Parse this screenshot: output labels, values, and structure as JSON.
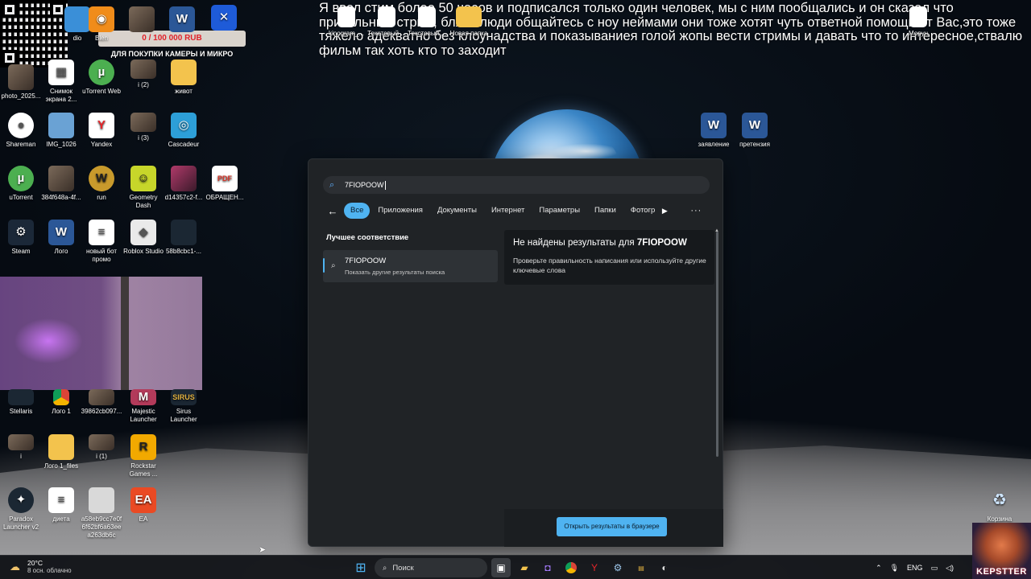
{
  "overlay": {
    "message": "Я ввел стим более 50 часов и подписался только один человек, мы с ним пообщались и он сказал что прикольный стрим, блять люди общайтесь с ноу неймами они тоже хотят чуть ответной помощи от Вас,это тоже тяжело адекватно без клоунадства и показываниея голой жопы вести стримы и давать что то интересное,ствалю фильм  так хоть кто то заходит"
  },
  "donation": {
    "progress_text": "0 / 100 000 RUB",
    "caption": "ДЛЯ ПОКУПКИ КАМЕРЫ И МИКРО"
  },
  "desktop_icons": {
    "col1": [
      {
        "label": "photo_2025...",
        "icon": "photo-icon"
      },
      {
        "label": "Shareman",
        "icon": "shareman-icon"
      },
      {
        "label": "uTorrent",
        "icon": "utorrent-icon"
      },
      {
        "label": "Steam",
        "icon": "steam-icon"
      },
      {
        "label": "Stellaris",
        "icon": "stellaris-icon"
      },
      {
        "label": "i",
        "icon": "image-icon"
      },
      {
        "label": "Paradox Launcher v2",
        "icon": "paradox-icon"
      }
    ],
    "col2": [
      {
        "label": "Снимок экрана 2...",
        "icon": "screenshot-icon"
      },
      {
        "label": "IMG_1026",
        "icon": "image-icon"
      },
      {
        "label": "384f648a-4f...",
        "icon": "image-icon"
      },
      {
        "label": "Лого",
        "icon": "word-icon"
      },
      {
        "label": "Лого 1",
        "icon": "chrome-icon"
      },
      {
        "label": "Лого 1_files",
        "icon": "folder-icon"
      },
      {
        "label": "диета",
        "icon": "document-icon"
      }
    ],
    "col3": [
      {
        "label": "uTorrent Web",
        "icon": "utorrent-web-icon"
      },
      {
        "label": "Yandex",
        "icon": "yandex-icon"
      },
      {
        "label": "run",
        "icon": "wow-icon"
      },
      {
        "label": "новый бот промо",
        "icon": "document-icon"
      },
      {
        "label": "39862cb097...",
        "icon": "image-icon"
      },
      {
        "label": "i (1)",
        "icon": "image-icon"
      },
      {
        "label": "a58eb9cc7e0f 6f62bf6a63ee a263db6c",
        "icon": "image-icon"
      }
    ],
    "col4": [
      {
        "label": "i (2)",
        "icon": "image-icon"
      },
      {
        "label": "i (3)",
        "icon": "image-icon"
      },
      {
        "label": "Geometry Dash",
        "icon": "geometry-dash-icon"
      },
      {
        "label": "Roblox Studio",
        "icon": "roblox-icon"
      },
      {
        "label": "Majestic Launcher",
        "icon": "majestic-icon"
      },
      {
        "label": "Rockstar Games ...",
        "icon": "rockstar-icon"
      },
      {
        "label": "EA",
        "icon": "ea-icon"
      }
    ],
    "col5": [
      {
        "label": "живот",
        "icon": "folder-icon"
      },
      {
        "label": "Cascadeur",
        "icon": "cascadeur-icon"
      },
      {
        "label": "d14357c2-f...",
        "icon": "image-icon"
      },
      {
        "label": "58b8cbc1-...",
        "icon": "image-icon"
      },
      {
        "label": "Sirus Launcher",
        "icon": "sirus-icon"
      }
    ],
    "col6": [
      {
        "label": "ОБРАЩЕН...",
        "icon": "pdf-icon"
      }
    ],
    "top_row": [
      {
        "label": "dio",
        "icon": "app-icon"
      },
      {
        "label": "Blen",
        "icon": "blender-icon"
      }
    ],
    "right_top": [
      {
        "label": "kinogram_...",
        "icon": "document-icon"
      },
      {
        "label": "Текстовый ...",
        "icon": "document-icon"
      },
      {
        "label": "Текстовый ...",
        "icon": "document-icon"
      },
      {
        "label": "Новая папка",
        "icon": "folder-icon"
      },
      {
        "label": "Морун",
        "icon": "document-icon"
      }
    ],
    "right_mid": [
      {
        "label": "заявление",
        "icon": "word-icon"
      },
      {
        "label": "претензия",
        "icon": "word-icon"
      }
    ],
    "recycle": {
      "label": "Корзина",
      "icon": "recycle-bin-icon"
    }
  },
  "search": {
    "query": "7FIOPOOW",
    "filters": [
      "Все",
      "Приложения",
      "Документы",
      "Интернет",
      "Параметры",
      "Папки",
      "Фотогр"
    ],
    "active_filter": "Все",
    "best_match_heading": "Лучшее соответствие",
    "result": {
      "title": "7FIOPOOW",
      "subtitle": "Показать другие результаты поиска"
    },
    "details": {
      "no_results_prefix": "Не найдены результаты для",
      "no_results_query": "7FIOPOOW",
      "hint": "Проверьте правильность написания или используйте другие ключевые слова"
    },
    "open_in_browser": "Открыть результаты в браузере"
  },
  "taskbar": {
    "weather_temp": "20°C",
    "weather_cond": "8 осн. облачно",
    "search_placeholder": "Поиск",
    "lang": "ENG"
  },
  "streamer": {
    "logo_text": "KEPSTTER"
  },
  "colors": {
    "accent": "#4fb3f1",
    "panel_bg": "#202326",
    "donate_red": "#e0222a"
  }
}
